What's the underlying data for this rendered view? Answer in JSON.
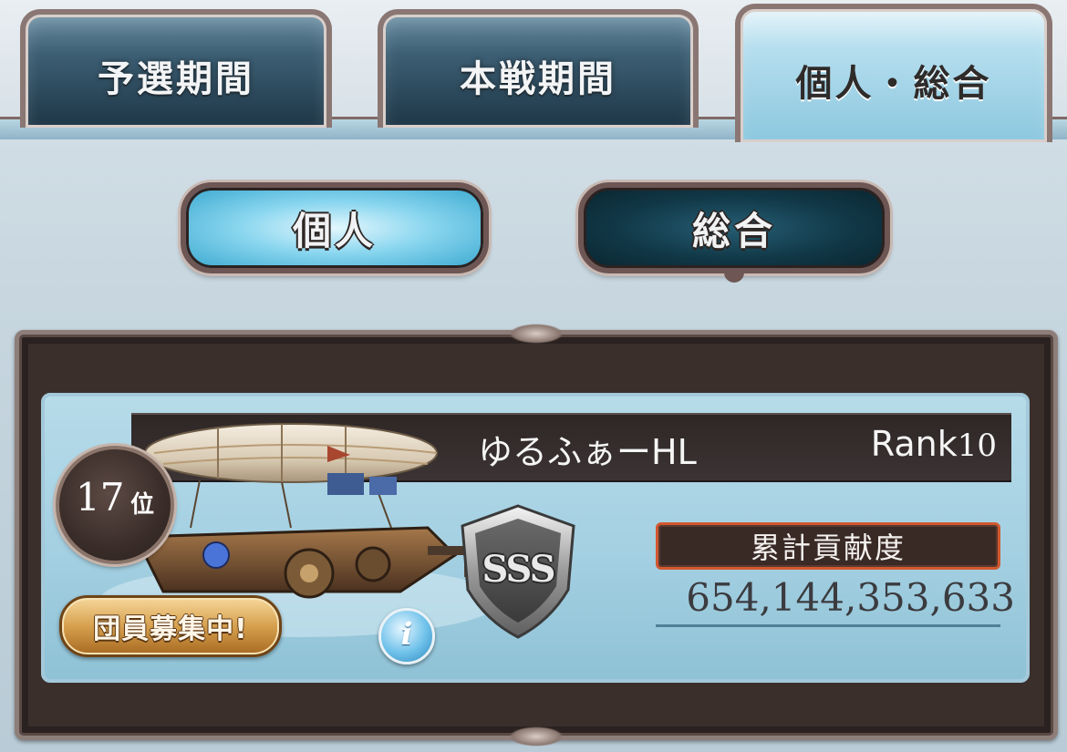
{
  "tabs": [
    {
      "label": "予選期間",
      "active": false
    },
    {
      "label": "本戦期間",
      "active": false
    },
    {
      "label": "個人・総合",
      "active": true
    }
  ],
  "toggle": {
    "personal_label": "個人",
    "overall_label": "総合",
    "selected": "個人"
  },
  "ranking": {
    "place_number": "17",
    "place_unit": "位",
    "crew_name": "ゆるふぁーHL",
    "rank_prefix": "Rank",
    "rank_value": "10",
    "recruit_label": "団員募集中!",
    "info_icon": "i",
    "grade": "SSS",
    "contribution_label": "累計貢献度",
    "contribution_value": "654,144,353,633"
  },
  "colors": {
    "active_tab": "#8cc7df",
    "dark_tab": "#1d3646",
    "frame": "#3a2f2b",
    "card": "#a4d0e2",
    "contribution_border": "#d1582f"
  },
  "icons": {
    "info": "info-icon",
    "grade": "grade-shield-icon",
    "airship": "airship-image"
  }
}
